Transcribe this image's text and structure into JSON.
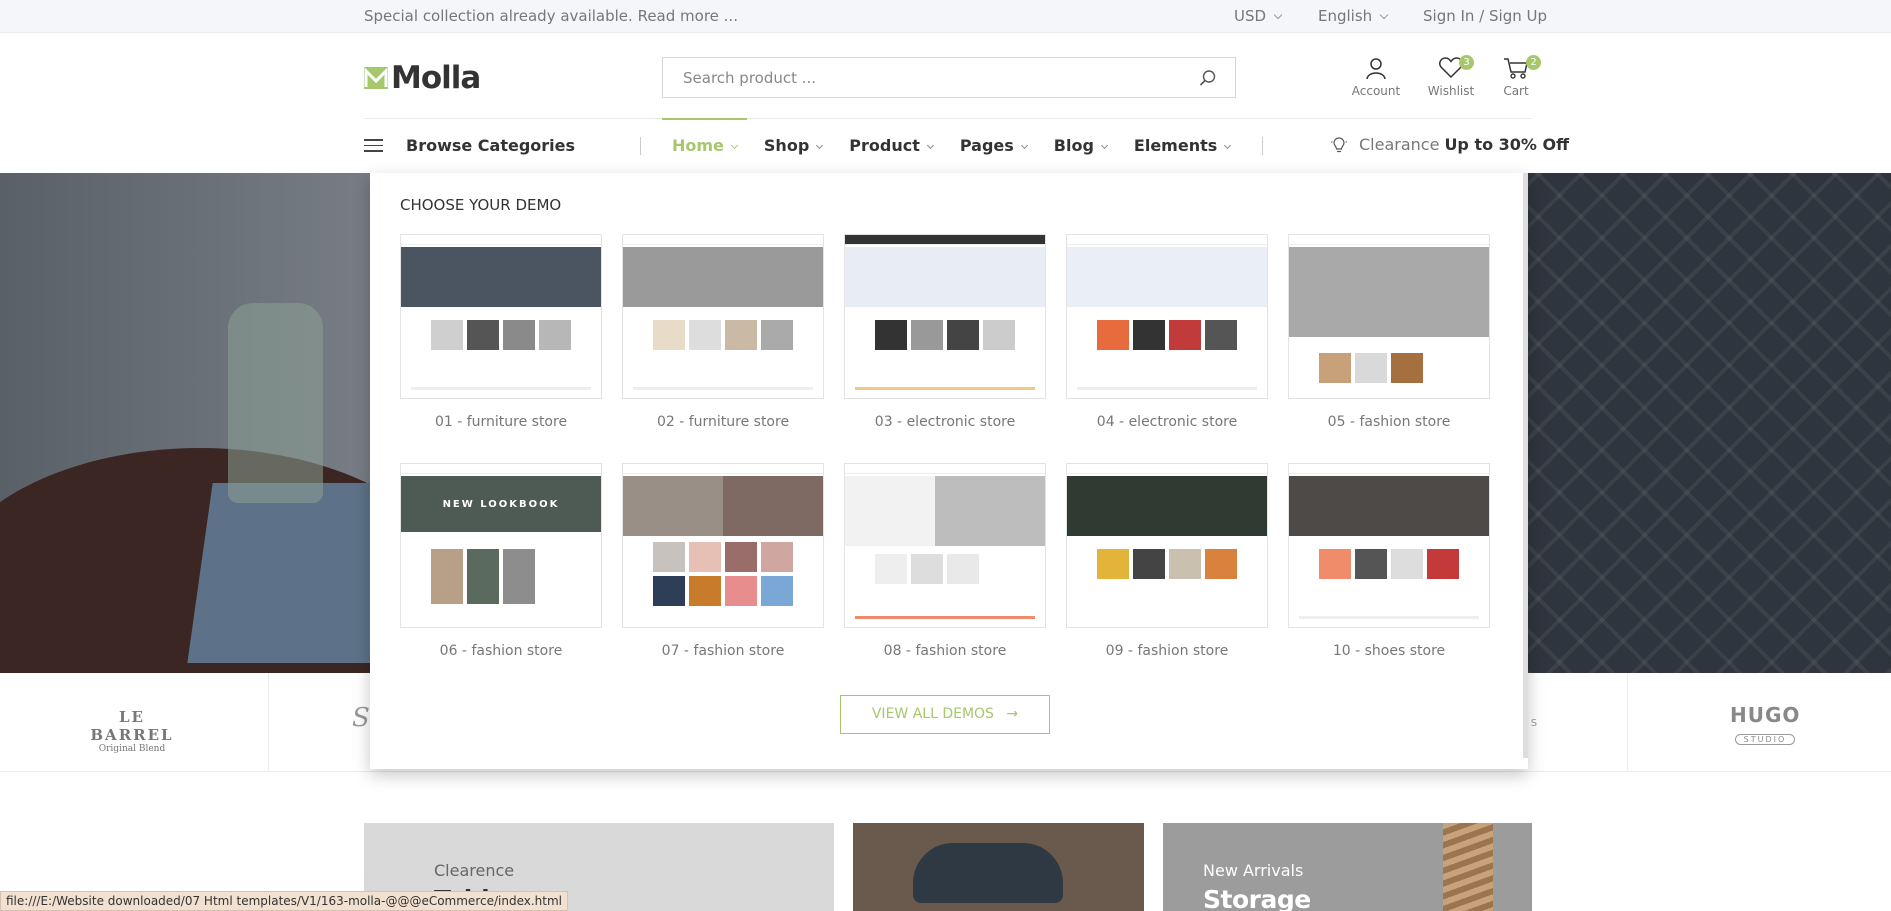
{
  "topbar": {
    "promo": "Special collection already available. Read more ...",
    "currency": "USD",
    "language": "English",
    "signin": "Sign In / Sign Up"
  },
  "header": {
    "logo": "Molla",
    "search_placeholder": "Search product ...",
    "account_label": "Account",
    "wishlist_label": "Wishlist",
    "wishlist_count": "3",
    "cart_label": "Cart",
    "cart_count": "2"
  },
  "nav": {
    "browse": "Browse Categories",
    "items": [
      {
        "label": "Home"
      },
      {
        "label": "Shop"
      },
      {
        "label": "Product"
      },
      {
        "label": "Pages"
      },
      {
        "label": "Blog"
      },
      {
        "label": "Elements"
      }
    ],
    "clearance_prefix": "Clearance",
    "clearance_strong": "Up to 30% Off"
  },
  "mega": {
    "title": "CHOOSE YOUR DEMO",
    "demos": [
      {
        "label": "01 - furniture store"
      },
      {
        "label": "02 - furniture store"
      },
      {
        "label": "03 - electronic store"
      },
      {
        "label": "04 - electronic store"
      },
      {
        "label": "05 - fashion store"
      },
      {
        "label": "06 - fashion store"
      },
      {
        "label": "07 - fashion store"
      },
      {
        "label": "08 - fashion store"
      },
      {
        "label": "09 - fashion store"
      },
      {
        "label": "10 - shoes store"
      }
    ],
    "view_all": "VIEW ALL DEMOS",
    "view_all_arrow": "→"
  },
  "brands": {
    "lebarrel_name": "LE BARREL",
    "lebarrel_tag": "Original Blend",
    "hugo_name": "HUGO",
    "hugo_tag": "STUDIO"
  },
  "banners": {
    "b1_sub": "Clearence",
    "b1_title": "Tables",
    "b3_sub": "New Arrivals",
    "b3_title": "Storage"
  },
  "statusbar": "file:///E:/Website downloaded/07 Html templates/V1/163-molla-@@@eCommerce/index.html",
  "colors": {
    "accent": "#a6c76c"
  }
}
